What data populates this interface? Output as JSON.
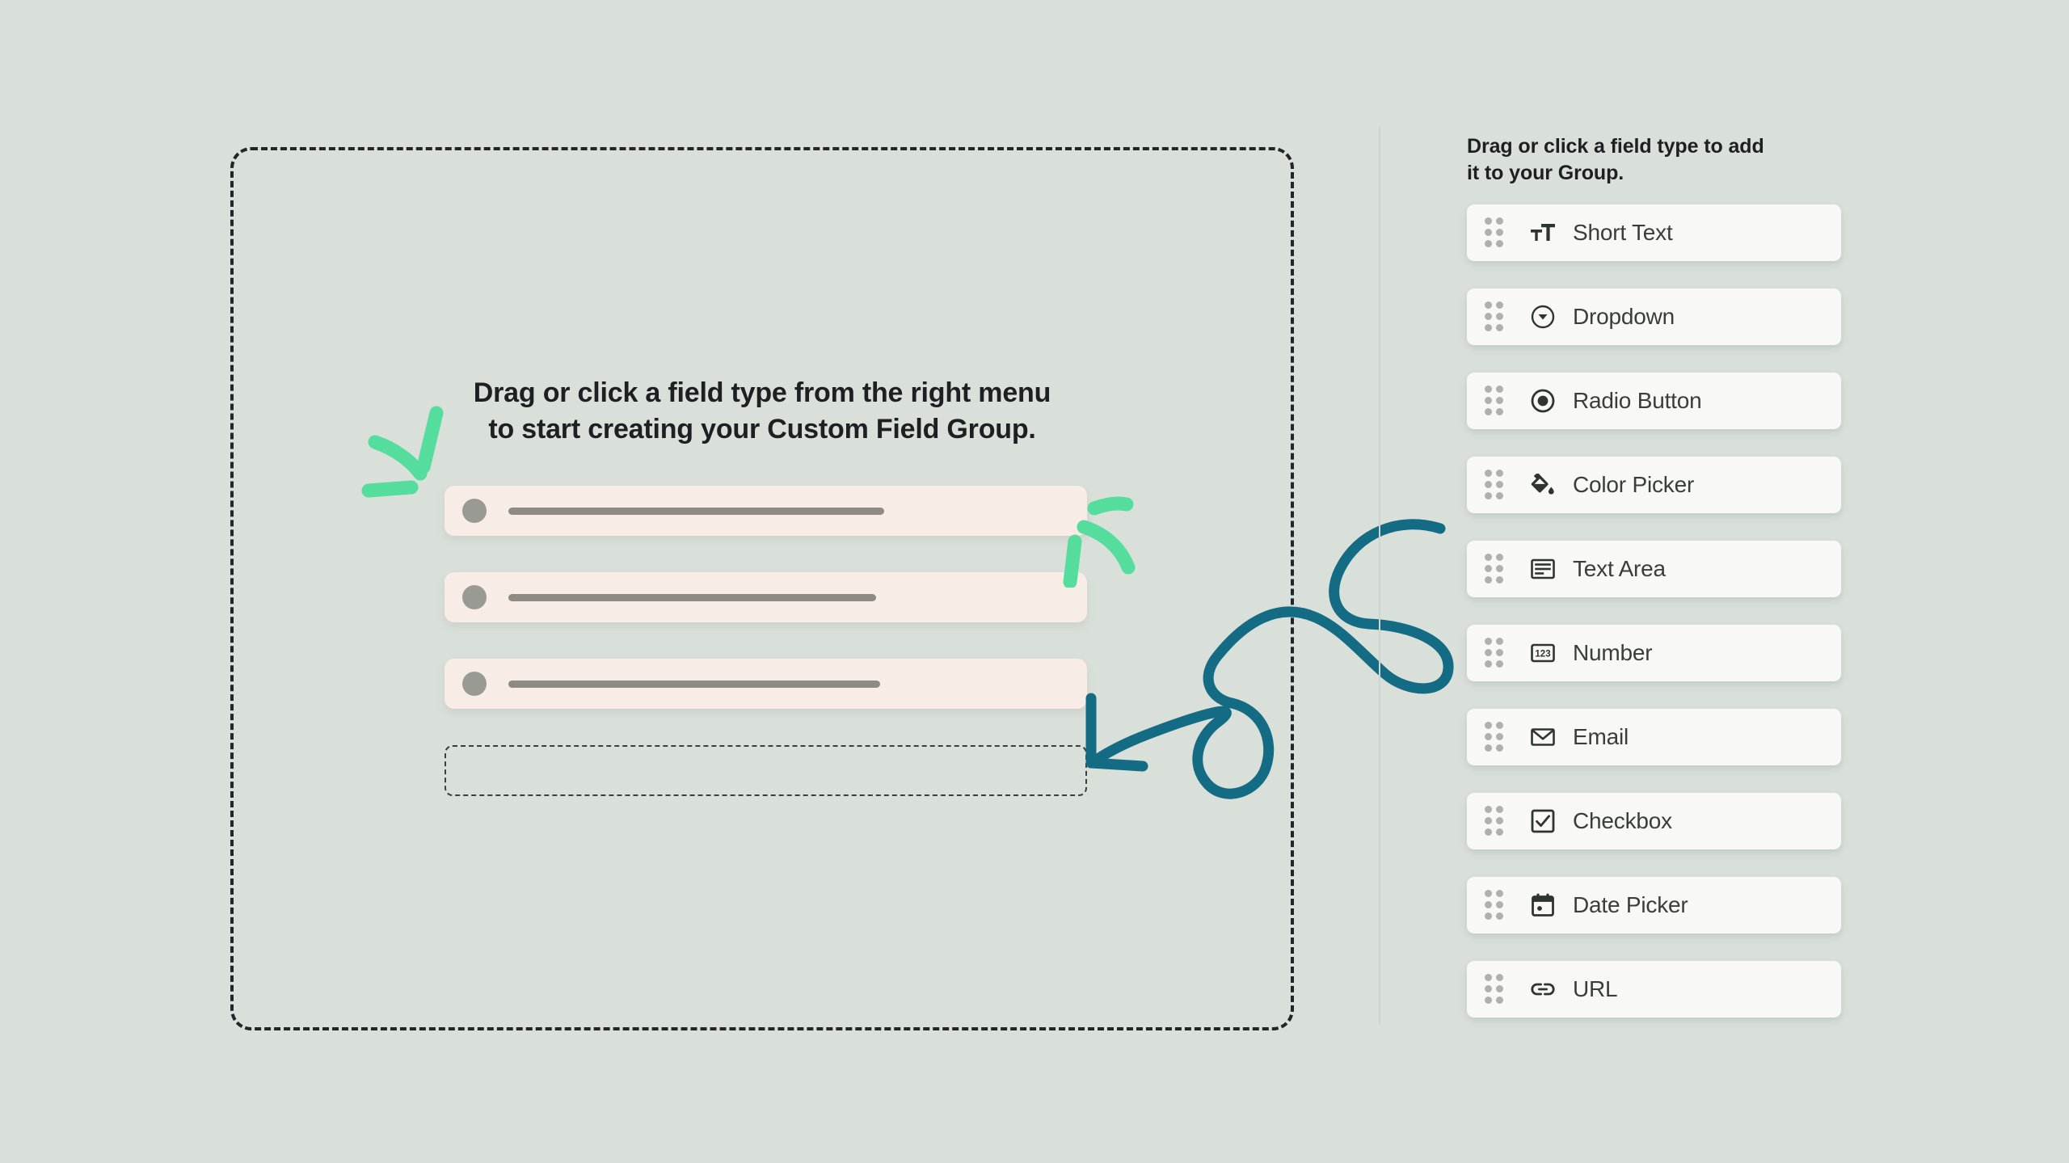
{
  "theme": {
    "background": "#d9dfd9",
    "card_background": "#f8f8f7",
    "skeleton_background": "#f7ece6",
    "accent_teal": "#146c84",
    "accent_green": "#55dd9d",
    "text_dark": "#1c2023",
    "label_text": "#3a3d3a",
    "dashed_border": "#22262a"
  },
  "canvas": {
    "heading": "Drag or click a field type from the right menu\nto start creating your Custom Field Group.",
    "skeleton_rows": [
      {
        "label": ""
      },
      {
        "label": ""
      },
      {
        "label": ""
      }
    ],
    "drop_placeholder_label": ""
  },
  "panel": {
    "title": "Drag or click a field type to add\nit to your Group.",
    "items": [
      {
        "label": "Short Text",
        "icon": "short-text-icon"
      },
      {
        "label": "Dropdown",
        "icon": "dropdown-icon"
      },
      {
        "label": "Radio Button",
        "icon": "radio-button-icon"
      },
      {
        "label": "Color Picker",
        "icon": "color-picker-icon"
      },
      {
        "label": "Text Area",
        "icon": "text-area-icon"
      },
      {
        "label": "Number",
        "icon": "number-icon"
      },
      {
        "label": "Email",
        "icon": "email-icon"
      },
      {
        "label": "Checkbox",
        "icon": "checkbox-icon"
      },
      {
        "label": "Date Picker",
        "icon": "date-picker-icon"
      },
      {
        "label": "URL",
        "icon": "url-icon"
      }
    ],
    "drag_handle_name": "drag-handle-icon"
  },
  "decorations": {
    "sparkle_left": "green-sparkle-left",
    "sparkle_right": "green-sparkle-right",
    "swirl_arrow": "teal-swirl-arrow"
  }
}
